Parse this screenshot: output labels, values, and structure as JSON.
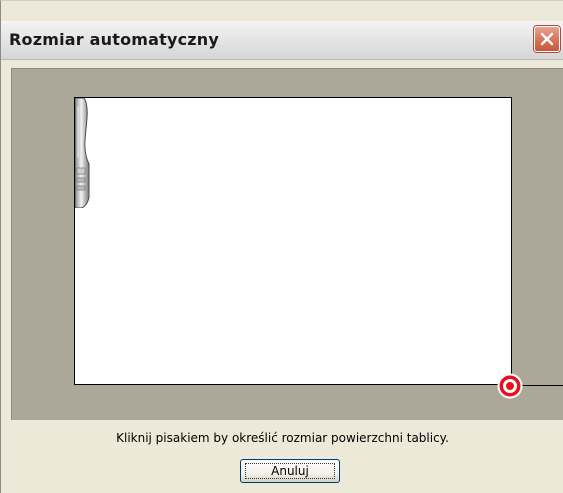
{
  "window": {
    "title": "Rozmiar automatyczny",
    "close_icon": "close-icon",
    "accent_close": "#d9765c"
  },
  "stage": {
    "background": "#aca899",
    "board_background": "#ffffff",
    "pen_icon": "pen-icon",
    "target_icon": "target-icon",
    "target_color": "#e8101a"
  },
  "footer": {
    "instruction": "Kliknij pisakiem by określić rozmiar powierzchni tablicy.",
    "cancel_label": "Anuluj"
  }
}
